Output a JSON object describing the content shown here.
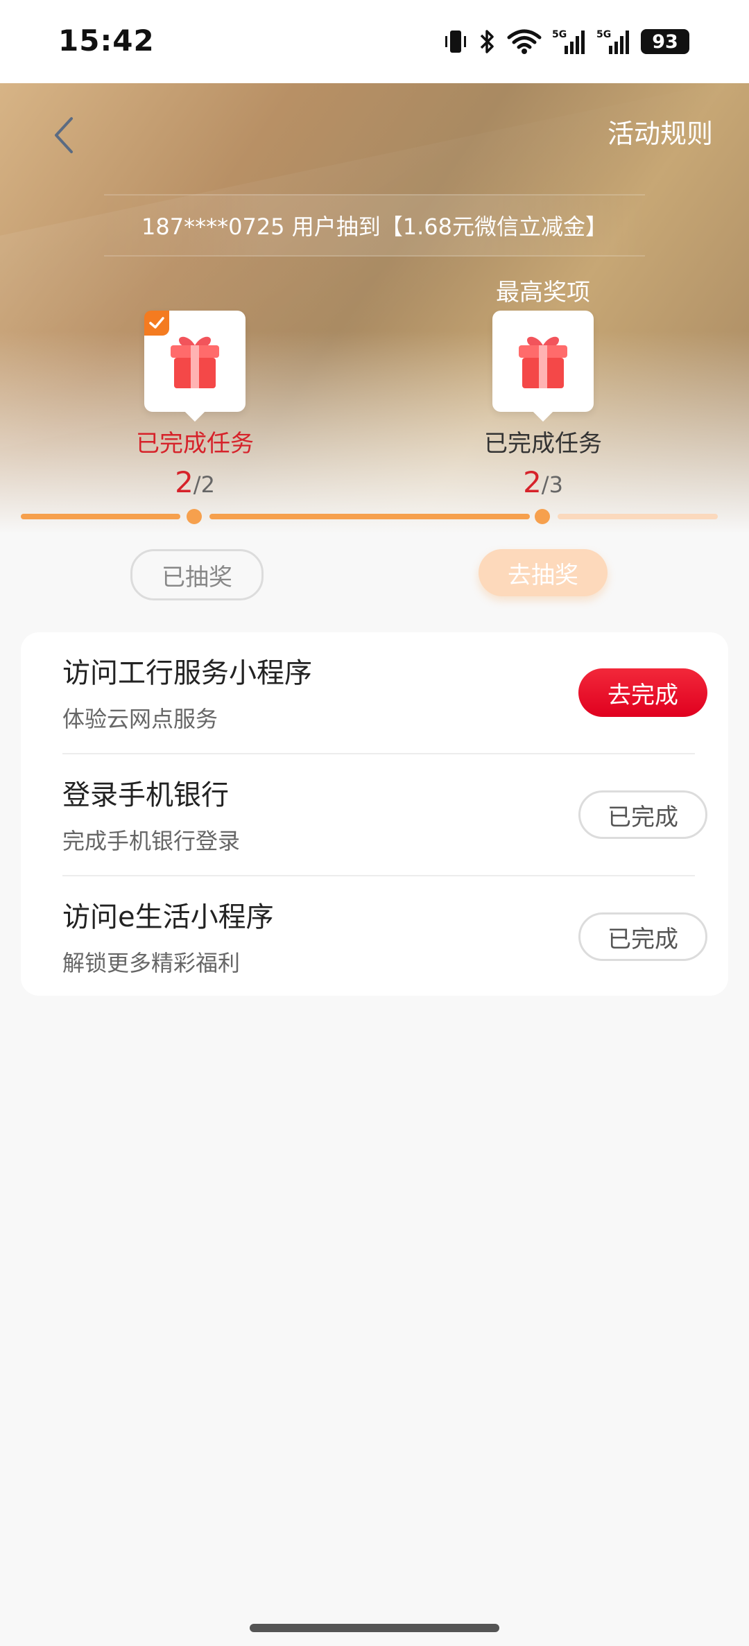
{
  "status_bar": {
    "time": "15:42",
    "icons": [
      "vibrate-icon",
      "bluetooth-icon",
      "wifi-icon",
      "signal-5g-icon",
      "signal-5g-icon"
    ],
    "battery": "93"
  },
  "header": {
    "back_icon": "chevron-left-icon",
    "rules_label": "活动规则"
  },
  "ticker": {
    "text": "187****0725 用户抽到【1.68元微信立减金】"
  },
  "milestones": [
    {
      "tag": "",
      "icon": "gift-icon",
      "completed_check": true,
      "label": "已完成任务",
      "label_color": "#d6222a",
      "done": "2",
      "sep": "/",
      "total": "2"
    },
    {
      "tag": "最高奖项",
      "icon": "gift-icon",
      "completed_check": false,
      "label": "已完成任务",
      "label_color": "#333333",
      "done": "2",
      "sep": "/",
      "total": "3"
    }
  ],
  "progress": {
    "filled_color": "#f6a04d",
    "empty_color": "#fbd9bd"
  },
  "draw_buttons": {
    "done_label": "已抽奖",
    "go_label": "去抽奖"
  },
  "tasks": [
    {
      "title": "访问工行服务小程序",
      "subtitle": "体验云网点服务",
      "button": "去完成",
      "state": "active"
    },
    {
      "title": "登录手机银行",
      "subtitle": "完成手机银行登录",
      "button": "已完成",
      "state": "done"
    },
    {
      "title": "访问e生活小程序",
      "subtitle": "解锁更多精彩福利",
      "button": "已完成",
      "state": "done"
    }
  ],
  "colors": {
    "accent_red": "#e0001f",
    "accent_orange": "#f6a04d"
  }
}
